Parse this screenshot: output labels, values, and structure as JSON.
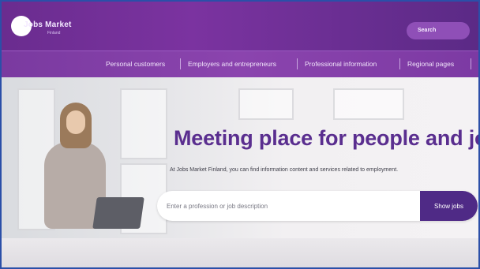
{
  "header": {
    "logo_text": "Jobs Market",
    "logo_subtext": "Finland",
    "search_label": "Search"
  },
  "nav": {
    "items": [
      "Personal customers",
      "Employers and entrepreneurs",
      "Professional information",
      "Regional pages"
    ]
  },
  "hero": {
    "title": "Meeting place for people and jobs",
    "subtitle": "At Jobs Market Finland, you can find information content and services related to employment.",
    "search_placeholder": "Enter a profession or job description",
    "button_label": "Show jobs"
  },
  "colors": {
    "brand_purple": "#6a2c8f",
    "nav_purple": "#8b44ae",
    "title_purple": "#5a2e8f",
    "button_purple": "#4f2a86"
  }
}
